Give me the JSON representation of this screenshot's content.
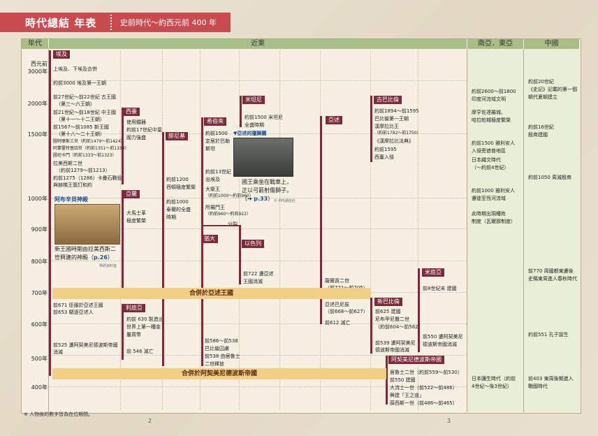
{
  "banner": {
    "title": "時代總結 年表",
    "subtitle": "史前時代～約西元前 400 年"
  },
  "headers": {
    "era": "年代",
    "near_east": "近東",
    "south_east_asia": "南亞．東亞",
    "china": "中國"
  },
  "years": [
    "西元前 3000年",
    "2000年",
    "1500年",
    "1000年",
    "900年",
    "800年",
    "700年",
    "600年",
    "500年",
    "400年"
  ],
  "egypt": {
    "label": "埃及",
    "t1": "上埃及、下埃及合併",
    "t2": "約前3000 埃及第一王朝",
    "t3": "前27世紀～前22世紀 古王國",
    "t4": "（第三～六王朝）",
    "t5": "前21世紀～前18世紀 中王國",
    "t6": "（第十一～十二王朝）",
    "t7": "前1567～前1085 新王國",
    "t8": "（第十八～二十王朝）",
    "t9": "圖特摩斯三世（約前1479～前1424）",
    "t10": "阿蒙霍特普四世（約前1351～前1334）",
    "t11": "圖坦卡門（約前1333～前1323）",
    "t12": "拉美西斯二世",
    "t13": "（約前1279～前1213）",
    "t14": "約前1275（1286）卡疊石戰役",
    "t15": "與赫梯王簽訂和約",
    "abu": "阿布辛貝神殿",
    "abu1": "新王國時期由拉美西斯二",
    "abu2": "世興建的神殿（",
    "abu_ref": "p.26",
    "abu3": "）",
    "credit": "學研資料室",
    "t16": "前671 臣服於亞述王國",
    "t17": "前653 驅逐亞述人",
    "t18": "前525 遭阿契美尼德波斯帝國",
    "t19": "消滅"
  },
  "hittites": {
    "label": "西臺",
    "t1": "使用鐵器",
    "t2": "約前17世紀中葉",
    "t3": "國力強盛"
  },
  "aramaeans": {
    "label": "亞蘭",
    "t1": "大馬士革",
    "t2": "極度繁榮"
  },
  "lydia": {
    "label": "利底亞",
    "t1": "約前 630 製造出",
    "t2": "世界上第一種金",
    "t3": "屬貨幣",
    "t4": "前 546 滅亡"
  },
  "phoenicia": {
    "label": "腓尼基",
    "t1": "約前1200",
    "t2": "西頓極度繁榮",
    "t3": "約前1000",
    "t4": "泰爾的全盛",
    "t5": "時期"
  },
  "hebrews": {
    "label": "希伯來",
    "t1": "約前1500",
    "t2": "定居於巴勒",
    "t3": "斯坦",
    "t4": "約前13世紀",
    "t5": "出埃及",
    "t6": "大衛王",
    "t7": "（約前1000～約前960）",
    "t8": "所羅門王",
    "t9": "（約前960～約前922）",
    "split": "分裂",
    "judah": "猶大",
    "israel": "以色列",
    "t10": "前586～前538",
    "t11": "巴比倫囚虜",
    "t12": "前538 由居魯士",
    "t13": "二世釋放",
    "t14": "前722 遭亞述",
    "t15": "王國消滅"
  },
  "mitanni": {
    "label": "米坦尼",
    "t1": "約前1500 米坦尼",
    "t2": "全盛時期"
  },
  "assyria_img": {
    "label": "▼亞述的獵獅圖",
    "t1": "國王乘坐在戰車上，",
    "t2": "正以弓箭射傷獅子。",
    "ref": "p.33",
    "credit": "© PPS通信社"
  },
  "assyria": {
    "label": "亞述",
    "t1": "薩爾貢二世",
    "t2": "（前721～前705）",
    "t3": "亞述巴尼拔",
    "t4": "（前668～前627）",
    "t5": "前612 滅亡"
  },
  "babylon": {
    "label": "古巴比倫",
    "t1": "約前1894～前1595",
    "t2": "巴比倫第一王朝",
    "t3": "漢摩拉比王",
    "t4": "（約前1792～前1750）",
    "t5": "《漢摩拉比法典》",
    "t6": "約前1595",
    "t7": "西臺入侵"
  },
  "neo_babylon": {
    "label": "新巴比倫",
    "t1": "前625 建國",
    "t2": "尼布甲尼撒二世",
    "t3": "（約前604～前562）",
    "t4": "前539 遭阿契美尼",
    "t5": "德波斯帝國消滅"
  },
  "media": {
    "label": "米底亞",
    "t1": "前8世紀末 建國",
    "t2": "前550 遭阿契美尼",
    "t3": "德波斯帝國消滅"
  },
  "persia": {
    "label": "阿契美尼德波斯帝國",
    "t1": "居魯士二世（約前559～前530）",
    "t2": "前550 建國",
    "t3": "大流士一世（前522～前486）",
    "t4": "興建「王之道」",
    "t5": "薛西斯一世（前486～前465）"
  },
  "bands": {
    "assyria": "合併於亞述王國",
    "persia": "合併於阿契美尼德波斯帝國"
  },
  "south_asia": {
    "t1": "約前2600～前1800",
    "t2": "印度河流域文明",
    "t3": "摩亨佐達羅城、",
    "t4": "哈拉帕城極度繁榮",
    "t5": "約前1500 雅利安人",
    "t6": "入侵旁遮普地區",
    "t7": "日本繩文時代",
    "t8": "（～約前4世紀）",
    "t9": "約前1000 雅利安人",
    "t10": "遷徙至恆河流域",
    "t11": "此時期出現種姓",
    "t12": "制度（瓦爾那制度）",
    "t13": "日本彌生時代（約前",
    "t14": "4世紀～後3世紀）"
  },
  "china": {
    "t1": "約前20世紀",
    "t2": "《史記》記載的第一個",
    "t3": "朝代夏朝建立",
    "t4": "約前16世紀",
    "t5": "殷商建國",
    "t6": "約前1050 周滅殷商",
    "t7": "前770 周國都東遷後",
    "t8": "史稱東周進入春秋時代",
    "t9": "約前551 孔子誕生",
    "t10": "前403 東周後期進入",
    "t11": "戰國時代"
  },
  "footnote": "※ 人物後的數字皆為在位期間。",
  "pages": {
    "left": "2",
    "right": "3"
  }
}
